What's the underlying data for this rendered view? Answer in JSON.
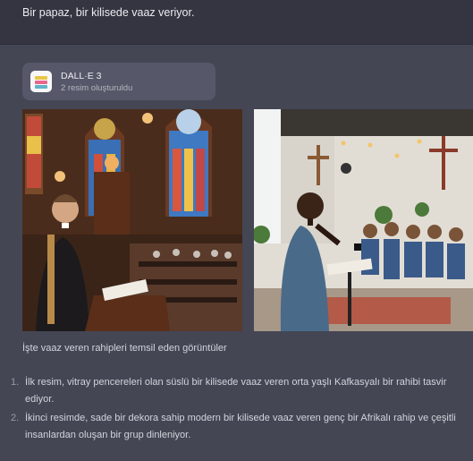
{
  "user_message": "Bir papaz, bir kilisede vaaz veriyor.",
  "tool": {
    "name": "DALL·E 3",
    "status": "2 resim oluşturuldu",
    "icon": "dalle-palette-icon"
  },
  "images": [
    {
      "alt": "church-sermon-image-1"
    },
    {
      "alt": "church-sermon-image-2"
    }
  ],
  "intro_text": "İşte vaaz veren rahipleri temsil eden görüntüler",
  "list": [
    {
      "number": "1.",
      "text": "İlk resim, vitray pencereleri olan süslü bir kilisede vaaz veren orta yaşlı Kafkasyalı bir rahibi tasvir ediyor."
    },
    {
      "number": "2.",
      "text": "İkinci resimde, sade bir dekora sahip modern bir kilisede vaaz veren genç bir Afrikalı rahip ve çeşitli insanlardan oluşan bir grup dinleniyor."
    }
  ],
  "colors": {
    "user_bg": "#343541",
    "assistant_bg": "#444654",
    "card_bg": "#565869"
  }
}
